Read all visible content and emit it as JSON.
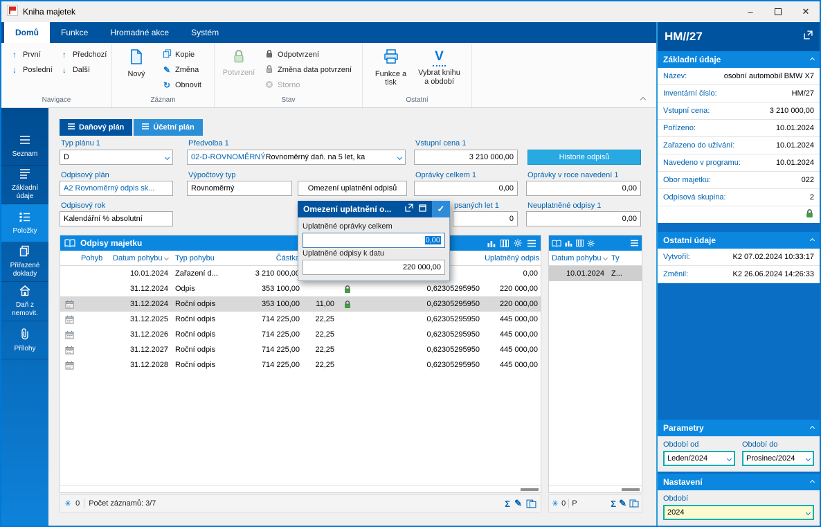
{
  "colors": {
    "accent_blue": "#0078D7",
    "dark_blue": "#00539F",
    "header_blue": "#0B87E0",
    "label_blue": "#0063B1",
    "light_button_blue": "#29A9E1",
    "lock_green": "#43A047",
    "selected_row_gray": "#D9D9D9",
    "combo_teal_border": "#00AEB4",
    "field_yellow": "#FBFBCF"
  },
  "icons": {
    "minimize": "–",
    "close": "✕",
    "arrow_up": "↑",
    "arrow_down": "↓",
    "refresh": "↻",
    "pencil": "✎",
    "check": "✓",
    "sum": "Σ",
    "asterisk": "✳",
    "v_letter": "V"
  },
  "window": {
    "title": "Kniha majetek"
  },
  "menu": {
    "tabs": [
      {
        "label": "Domů",
        "active": true
      },
      {
        "label": "Funkce",
        "active": false
      },
      {
        "label": "Hromadné akce",
        "active": false
      },
      {
        "label": "Systém",
        "active": false
      }
    ]
  },
  "ribbon": {
    "navigace": {
      "group_label": "Navigace",
      "first": "První",
      "last": "Poslední",
      "prev": "Předchozí",
      "next": "Další"
    },
    "zaznam": {
      "group_label": "Záznam",
      "new": "Nový",
      "copy": "Kopie",
      "change": "Změna",
      "refresh": "Obnovit"
    },
    "stav": {
      "group_label": "Stav",
      "confirm": "Potvrzení",
      "unconfirm": "Odpotvrzení",
      "change_date": "Změna data potvrzení",
      "storno": "Storno"
    },
    "ostatni": {
      "group_label": "Ostatní",
      "functions_print": "Funkce a tisk",
      "select_book": "Vybrat knihu a období"
    }
  },
  "sidebar": {
    "items": [
      {
        "label": "Seznam",
        "active": false
      },
      {
        "label": "Základní údaje",
        "active": false
      },
      {
        "label": "Položky",
        "active": true
      },
      {
        "label": "Přiřazené doklady",
        "active": false
      },
      {
        "label": "Daň z nemovit.",
        "active": false
      },
      {
        "label": "Přílohy",
        "active": false
      }
    ]
  },
  "plan_tabs": [
    {
      "label": "Daňový plán",
      "active": true
    },
    {
      "label": "Účetní plán",
      "active": false
    }
  ],
  "form": {
    "typ_planu": {
      "label": "Typ plánu 1",
      "value": "D"
    },
    "predvolba": {
      "label": "Předvolba 1",
      "code": "02-D-ROVNOMĚRNÝ",
      "desc": " Rovnoměrný daň. na 5 let, ka"
    },
    "vstupni_cena": {
      "label": "Vstupní cena 1",
      "value": "3 210 000,00"
    },
    "historie_button": "Historie odpisů",
    "odpisovy_plan": {
      "label": "Odpisový plán",
      "value": "A2 Rovnoměrný odpis sk..."
    },
    "vypoctovy_typ": {
      "label": "Výpočtový typ",
      "value": "Rovnoměrný"
    },
    "omezeni_button": "Omezení uplatnění odpisů",
    "opravky_celkem": {
      "label": "Oprávky celkem 1",
      "value": "0,00"
    },
    "opravky_v_roce": {
      "label": "Oprávky v roce navedení 1",
      "value": "0,00"
    },
    "odpisovy_rok": {
      "label": "Odpisový rok",
      "value": "Kalendářní % absolutní"
    },
    "odepsanych_let": {
      "label": "psaných let 1",
      "value": "0"
    },
    "neuplatnene_odpisy": {
      "label": "Neuplatněné odpisy 1",
      "value": "0,00"
    }
  },
  "popup": {
    "title": "Omezení uplatnění o...",
    "field1": {
      "label": "Uplatněné oprávky celkem",
      "value": "0,00"
    },
    "field2": {
      "label": "Uplatněné odpisy k datu",
      "value": "220 000,00"
    }
  },
  "odpisy_table": {
    "title": "Odpisy majetku",
    "columns": [
      "",
      "Pohyb",
      "Datum pohybu",
      "Typ pohybu",
      "Částka",
      "",
      "",
      "",
      "Uplatněný odpis"
    ],
    "rows": [
      {
        "icon": "",
        "pohyb": "",
        "datum": "10.01.2024",
        "typ": "Zařazení d...",
        "castka": "3 210 000,00",
        "pct": "",
        "lock": false,
        "koef": "",
        "odpis": "0,00",
        "selected": false
      },
      {
        "icon": "",
        "pohyb": "",
        "datum": "31.12.2024",
        "typ": "Odpis",
        "castka": "353 100,00",
        "pct": "",
        "lock": true,
        "koef": "0,62305295950",
        "odpis": "220 000,00",
        "selected": false
      },
      {
        "icon": "calendar",
        "pohyb": "",
        "datum": "31.12.2024",
        "typ": "Roční odpis",
        "castka": "353 100,00",
        "pct": "11,00",
        "lock": true,
        "koef": "0,62305295950",
        "odpis": "220 000,00",
        "selected": true
      },
      {
        "icon": "calendar",
        "pohyb": "",
        "datum": "31.12.2025",
        "typ": "Roční odpis",
        "castka": "714 225,00",
        "pct": "22,25",
        "lock": false,
        "koef": "0,62305295950",
        "odpis": "445 000,00",
        "selected": false
      },
      {
        "icon": "calendar",
        "pohyb": "",
        "datum": "31.12.2026",
        "typ": "Roční odpis",
        "castka": "714 225,00",
        "pct": "22,25",
        "lock": false,
        "koef": "0,62305295950",
        "odpis": "445 000,00",
        "selected": false
      },
      {
        "icon": "calendar",
        "pohyb": "",
        "datum": "31.12.2027",
        "typ": "Roční odpis",
        "castka": "714 225,00",
        "pct": "22,25",
        "lock": false,
        "koef": "0,62305295950",
        "odpis": "445 000,00",
        "selected": false
      },
      {
        "icon": "calendar",
        "pohyb": "",
        "datum": "31.12.2028",
        "typ": "Roční odpis",
        "castka": "714 225,00",
        "pct": "22,25",
        "lock": false,
        "koef": "0,62305295950",
        "odpis": "445 000,00",
        "selected": false
      }
    ],
    "status": {
      "count": "0",
      "records": "Počet záznamů: 3/7"
    }
  },
  "pohyby_table": {
    "columns": [
      "Datum pohybu",
      "Ty"
    ],
    "rows": [
      {
        "datum": "10.01.2024",
        "typ": "Z...",
        "selected": true
      }
    ],
    "status": {
      "count": "0",
      "records": "P"
    }
  },
  "panel": {
    "title": "HM//27",
    "zakladni": {
      "header": "Základní údaje",
      "rows": [
        {
          "label": "Název:",
          "value": "osobní automobil BMW X7"
        },
        {
          "label": "Inventární číslo:",
          "value": "HM/27"
        },
        {
          "label": "Vstupní cena:",
          "value": "3 210 000,00"
        },
        {
          "label": "Pořízeno:",
          "value": "10.01.2024"
        },
        {
          "label": "Zařazeno do užívání:",
          "value": "10.01.2024"
        },
        {
          "label": "Navedeno v programu:",
          "value": "10.01.2024"
        },
        {
          "label": "Obor majetku:",
          "value": "022"
        },
        {
          "label": "Odpisová skupina:",
          "value": "2"
        }
      ]
    },
    "ostatni": {
      "header": "Ostatní údaje",
      "rows": [
        {
          "label": "Vytvořil:",
          "value": "K2 07.02.2024 10:33:17"
        },
        {
          "label": "Změnil:",
          "value": "K2 26.06.2024 14:26:33"
        }
      ]
    },
    "parametry": {
      "header": "Parametry",
      "obdobi_od": {
        "label": "Období od",
        "value": "Leden/2024"
      },
      "obdobi_do": {
        "label": "Období do",
        "value": "Prosinec/2024"
      }
    },
    "nastaveni": {
      "header": "Nastavení",
      "obdobi": {
        "label": "Období",
        "value": "2024"
      }
    }
  }
}
